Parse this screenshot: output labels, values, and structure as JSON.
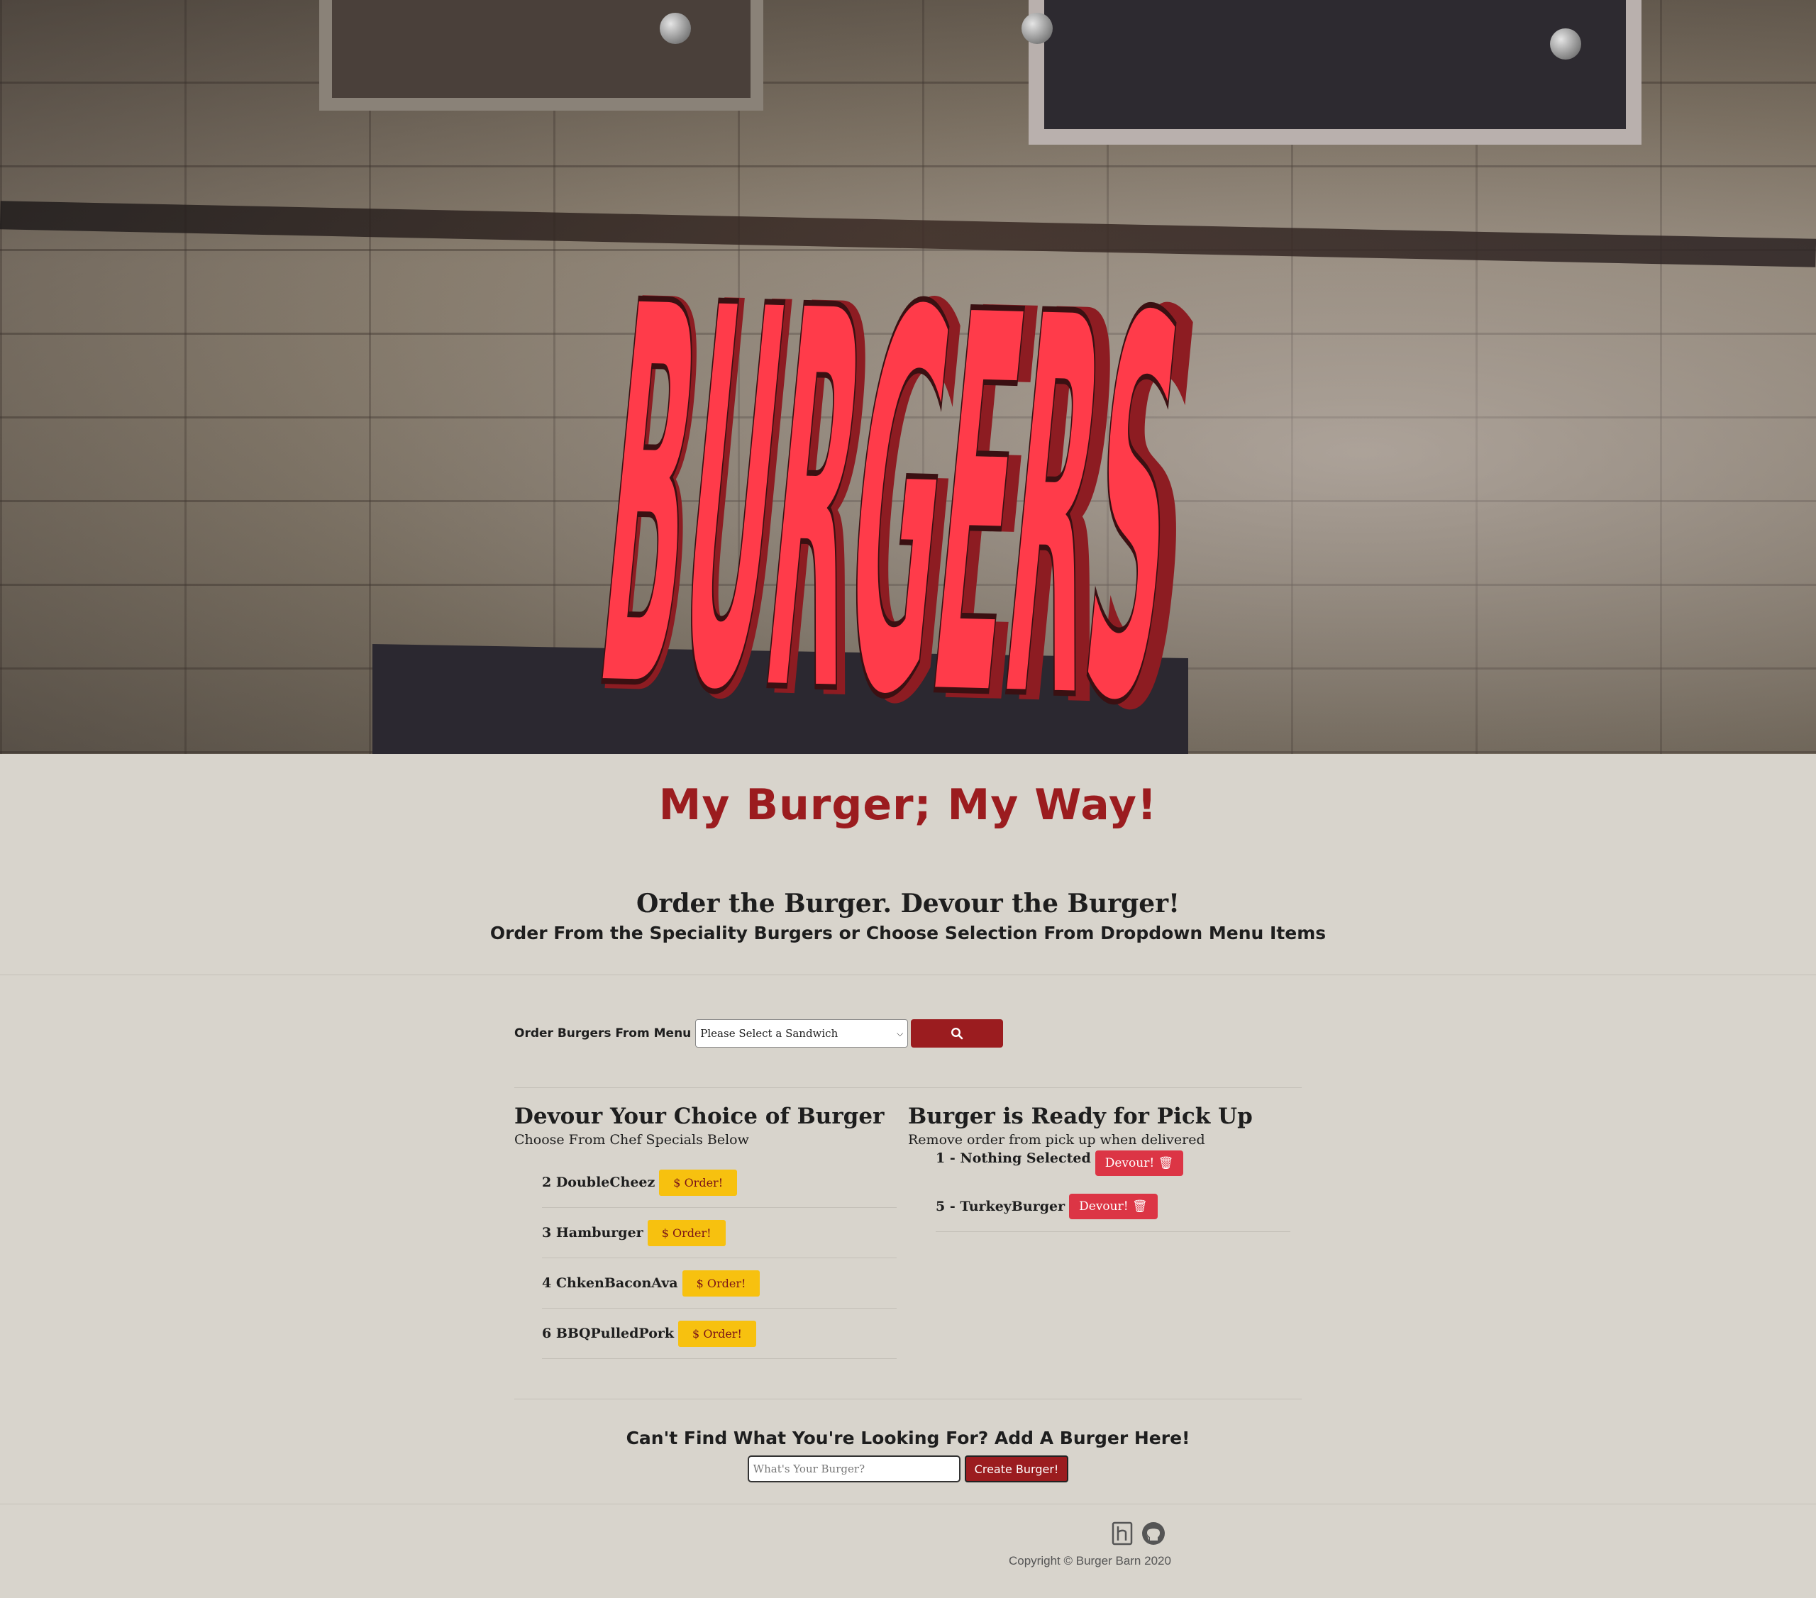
{
  "hero": {
    "sign_text": "BURGERS"
  },
  "title": "My Burger; My Way!",
  "headline": "Order the Burger. Devour the Burger!",
  "subline": "Order From the Speciality Burgers or Choose Selection From Dropdown Menu Items",
  "menu": {
    "label": "Order Burgers From Menu",
    "select_value": "Please Select a Sandwich",
    "search_icon": "search-icon"
  },
  "devour_col": {
    "title": "Devour Your Choice of Burger",
    "desc": "Choose From Chef Specials Below",
    "button_label": "$ Order!",
    "items": [
      {
        "label": "2 DoubleCheez"
      },
      {
        "label": "3 Hamburger"
      },
      {
        "label": "4 ChkenBaconAva"
      },
      {
        "label": "6 BBQPulledPork"
      }
    ]
  },
  "pickup_col": {
    "title": "Burger is Ready for Pick Up",
    "desc": "Remove order from pick up when delivered",
    "button_label": "Devour!",
    "items": [
      {
        "label": "1 - Nothing Selected"
      },
      {
        "label": "5 - TurkeyBurger"
      }
    ]
  },
  "add": {
    "title": "Can't Find What You're Looking For? Add A Burger Here!",
    "placeholder": "What's Your Burger?",
    "button_label": "Create Burger!"
  },
  "footer": {
    "copyright": "Copyright © Burger Barn 2020",
    "icons": [
      "heroku-icon",
      "github-icon"
    ]
  },
  "colors": {
    "accent": "#9b1c1f",
    "order_btn": "#f7c10f",
    "devour_btn": "#dc3545",
    "background": "#d8d4cc"
  }
}
